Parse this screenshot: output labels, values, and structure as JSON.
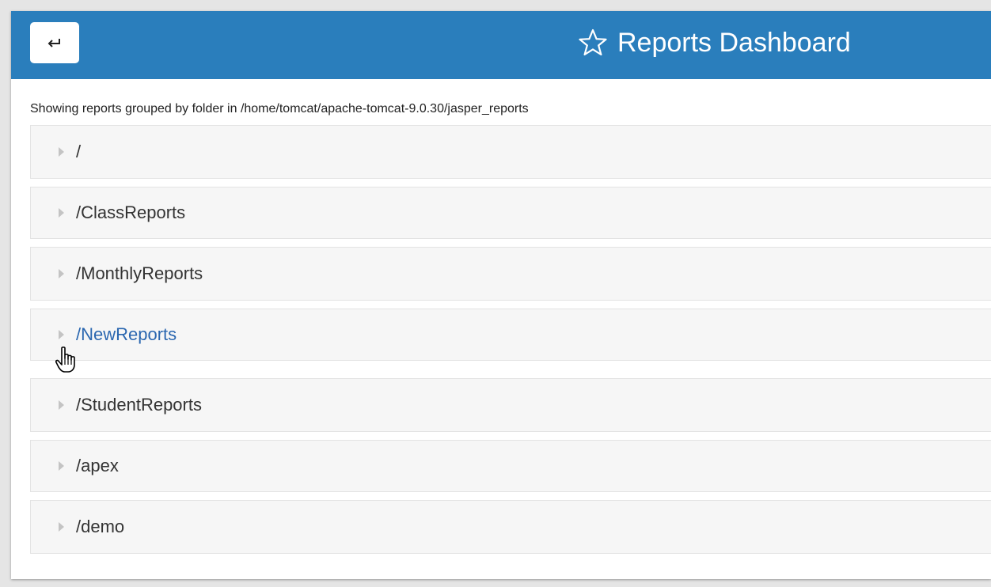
{
  "header": {
    "back_label": "↩",
    "title": "Reports Dashboard",
    "title_icon": "star-outline-icon",
    "background": "#2a7ebc"
  },
  "subtitle": "Showing reports grouped by folder in /home/tomcat/apache-tomcat-9.0.30/jasper_reports",
  "folders": [
    {
      "label": "/"
    },
    {
      "label": "/ClassReports"
    },
    {
      "label": "/MonthlyReports"
    },
    {
      "label": "/NewReports",
      "hovered": true
    },
    {
      "label": "/StudentReports"
    },
    {
      "label": "/apex"
    },
    {
      "label": "/demo"
    }
  ],
  "colors": {
    "accent": "#2a7ebc",
    "hover_link": "#2b67b0",
    "panel": "#f6f6f6"
  },
  "cursor": "hand-pointer-icon"
}
